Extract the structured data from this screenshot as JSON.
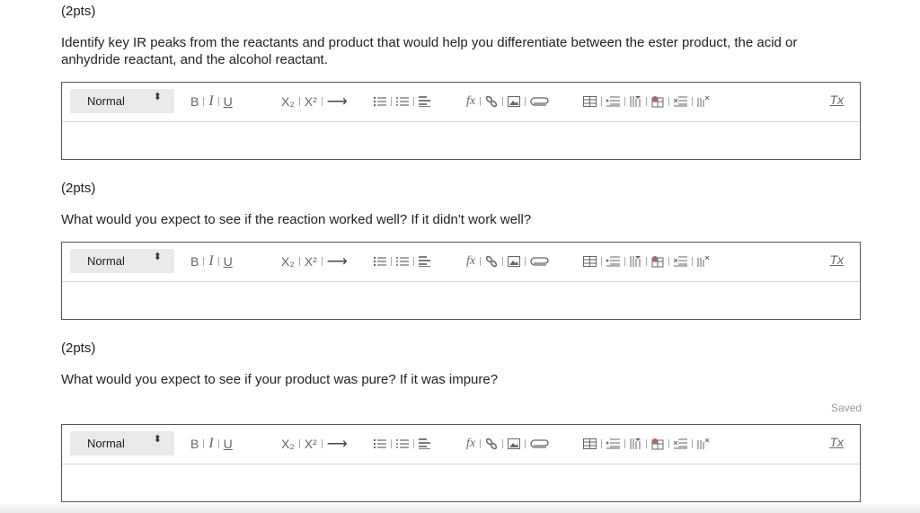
{
  "questions": [
    {
      "points": "(2pts)",
      "prompt": "Identify key IR peaks from the reactants and product that would help you differentiate between the ester product, the acid or anhydride reactant, and the alcohol reactant."
    },
    {
      "points": "(2pts)",
      "prompt": "What would you expect to see if the reaction worked well? If it didn't work well?"
    },
    {
      "points": "(2pts)",
      "prompt": "What would you expect to see if your product was pure? If it was impure?"
    }
  ],
  "editor": {
    "format_value": "Normal",
    "format_arrows": "⬍",
    "bold": "B",
    "italic": "I",
    "underline": "U",
    "subscript": "X₂",
    "superscript": "X²",
    "arrow": "⟶",
    "formula": "fx",
    "clear_format": "Tx"
  },
  "status": {
    "saved": "Saved"
  }
}
